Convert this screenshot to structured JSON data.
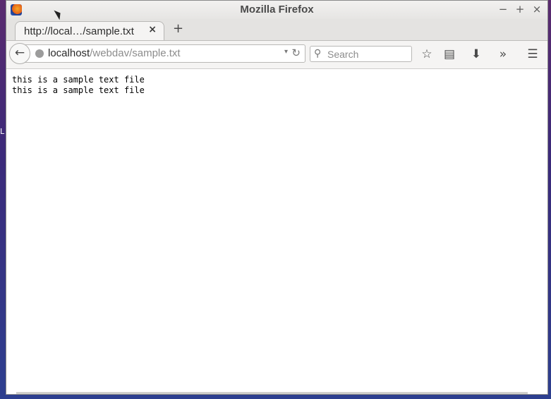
{
  "desktop": {
    "edge_letter": "L"
  },
  "window": {
    "title": "Mozilla Firefox",
    "controls": {
      "minimize": "−",
      "maximize": "+",
      "close": "×"
    }
  },
  "tabs": [
    {
      "label": "http://local…/sample.txt",
      "close": "×"
    }
  ],
  "new_tab_label": "+",
  "navbar": {
    "back": "←",
    "url_host": "localhost",
    "url_path": "/webdav/sample.txt",
    "dropdown": "▾",
    "reload": "↻",
    "search_placeholder": "Search",
    "search_icon": "⚲",
    "icons": {
      "bookmark": "☆",
      "reader": "▤",
      "download": "⬇",
      "overflow": "»",
      "menu": "☰"
    }
  },
  "content": {
    "lines": [
      "this is a sample text file",
      "this is a sample text file"
    ]
  }
}
